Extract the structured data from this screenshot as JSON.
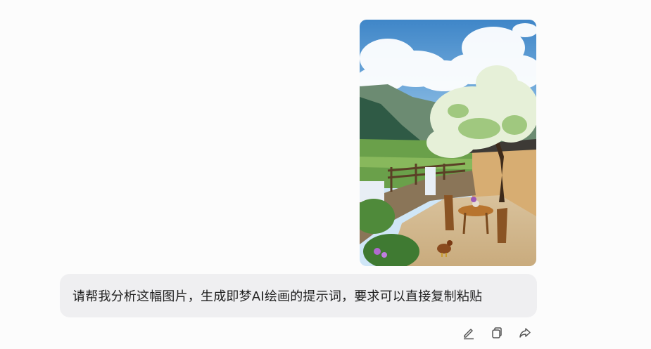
{
  "message": {
    "text": "请帮我分析这幅图片，生成即梦AI绘画的提示词，要求可以直接复制粘贴"
  },
  "attachment": {
    "kind": "photo",
    "description_icon": "countryside-courtyard-image"
  },
  "actions": [
    {
      "name": "edit-icon"
    },
    {
      "name": "copy-icon"
    },
    {
      "name": "share-icon"
    }
  ],
  "colors": {
    "bubble": "#efeff1",
    "text": "#1f1f1f",
    "icon": "#555555",
    "background": "#fcfcfc"
  }
}
